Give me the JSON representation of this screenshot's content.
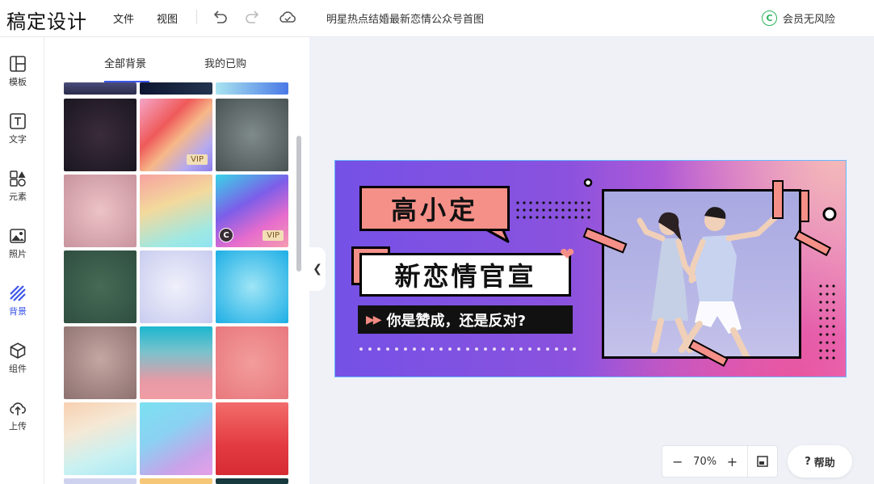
{
  "app": {
    "logo": "稿定设计",
    "menu_file": "文件",
    "menu_view": "视图",
    "document_title": "明星热点结婚最新恋情公众号首图",
    "member_text": "会员无风险",
    "icons": [
      "undo-icon",
      "redo-icon",
      "cloud-save-icon",
      "copyright-icon"
    ]
  },
  "rail": {
    "items": [
      {
        "label": "模板",
        "icon": "template-icon"
      },
      {
        "label": "文字",
        "icon": "text-icon"
      },
      {
        "label": "元素",
        "icon": "elements-icon"
      },
      {
        "label": "照片",
        "icon": "photo-icon"
      },
      {
        "label": "背景",
        "icon": "background-icon"
      },
      {
        "label": "组件",
        "icon": "component-icon"
      },
      {
        "label": "上传",
        "icon": "upload-icon"
      }
    ],
    "active": "背景"
  },
  "panel": {
    "tabs": [
      {
        "label": "全部背景",
        "active": true
      },
      {
        "label": "我的已购",
        "active": false
      }
    ],
    "vip_label": "VIP",
    "copyright_label": "C",
    "collapse_icon": "chevron-left-icon"
  },
  "canvas": {
    "title": "高小定",
    "headline": "新恋情官宣",
    "question": "你是赞成，还是反对?",
    "accent_color": "#f59088"
  },
  "bottom": {
    "zoom_minus": "−",
    "zoom_value": "70%",
    "zoom_plus": "+",
    "help_label": "帮助",
    "help_icon_glyph": "?"
  }
}
